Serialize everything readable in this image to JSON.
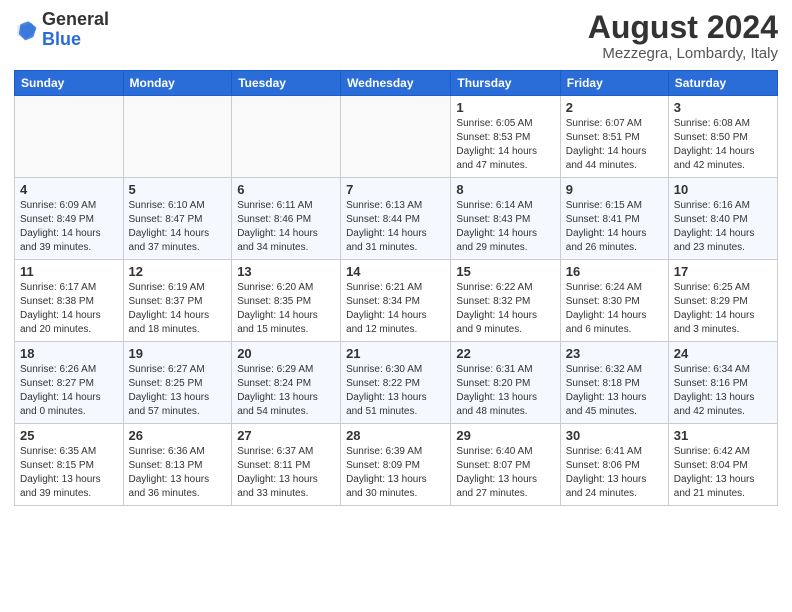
{
  "header": {
    "logo_general": "General",
    "logo_blue": "Blue",
    "month_title": "August 2024",
    "location": "Mezzegra, Lombardy, Italy"
  },
  "days_of_week": [
    "Sunday",
    "Monday",
    "Tuesday",
    "Wednesday",
    "Thursday",
    "Friday",
    "Saturday"
  ],
  "weeks": [
    [
      {
        "day": "",
        "info": ""
      },
      {
        "day": "",
        "info": ""
      },
      {
        "day": "",
        "info": ""
      },
      {
        "day": "",
        "info": ""
      },
      {
        "day": "1",
        "info": "Sunrise: 6:05 AM\nSunset: 8:53 PM\nDaylight: 14 hours\nand 47 minutes."
      },
      {
        "day": "2",
        "info": "Sunrise: 6:07 AM\nSunset: 8:51 PM\nDaylight: 14 hours\nand 44 minutes."
      },
      {
        "day": "3",
        "info": "Sunrise: 6:08 AM\nSunset: 8:50 PM\nDaylight: 14 hours\nand 42 minutes."
      }
    ],
    [
      {
        "day": "4",
        "info": "Sunrise: 6:09 AM\nSunset: 8:49 PM\nDaylight: 14 hours\nand 39 minutes."
      },
      {
        "day": "5",
        "info": "Sunrise: 6:10 AM\nSunset: 8:47 PM\nDaylight: 14 hours\nand 37 minutes."
      },
      {
        "day": "6",
        "info": "Sunrise: 6:11 AM\nSunset: 8:46 PM\nDaylight: 14 hours\nand 34 minutes."
      },
      {
        "day": "7",
        "info": "Sunrise: 6:13 AM\nSunset: 8:44 PM\nDaylight: 14 hours\nand 31 minutes."
      },
      {
        "day": "8",
        "info": "Sunrise: 6:14 AM\nSunset: 8:43 PM\nDaylight: 14 hours\nand 29 minutes."
      },
      {
        "day": "9",
        "info": "Sunrise: 6:15 AM\nSunset: 8:41 PM\nDaylight: 14 hours\nand 26 minutes."
      },
      {
        "day": "10",
        "info": "Sunrise: 6:16 AM\nSunset: 8:40 PM\nDaylight: 14 hours\nand 23 minutes."
      }
    ],
    [
      {
        "day": "11",
        "info": "Sunrise: 6:17 AM\nSunset: 8:38 PM\nDaylight: 14 hours\nand 20 minutes."
      },
      {
        "day": "12",
        "info": "Sunrise: 6:19 AM\nSunset: 8:37 PM\nDaylight: 14 hours\nand 18 minutes."
      },
      {
        "day": "13",
        "info": "Sunrise: 6:20 AM\nSunset: 8:35 PM\nDaylight: 14 hours\nand 15 minutes."
      },
      {
        "day": "14",
        "info": "Sunrise: 6:21 AM\nSunset: 8:34 PM\nDaylight: 14 hours\nand 12 minutes."
      },
      {
        "day": "15",
        "info": "Sunrise: 6:22 AM\nSunset: 8:32 PM\nDaylight: 14 hours\nand 9 minutes."
      },
      {
        "day": "16",
        "info": "Sunrise: 6:24 AM\nSunset: 8:30 PM\nDaylight: 14 hours\nand 6 minutes."
      },
      {
        "day": "17",
        "info": "Sunrise: 6:25 AM\nSunset: 8:29 PM\nDaylight: 14 hours\nand 3 minutes."
      }
    ],
    [
      {
        "day": "18",
        "info": "Sunrise: 6:26 AM\nSunset: 8:27 PM\nDaylight: 14 hours\nand 0 minutes."
      },
      {
        "day": "19",
        "info": "Sunrise: 6:27 AM\nSunset: 8:25 PM\nDaylight: 13 hours\nand 57 minutes."
      },
      {
        "day": "20",
        "info": "Sunrise: 6:29 AM\nSunset: 8:24 PM\nDaylight: 13 hours\nand 54 minutes."
      },
      {
        "day": "21",
        "info": "Sunrise: 6:30 AM\nSunset: 8:22 PM\nDaylight: 13 hours\nand 51 minutes."
      },
      {
        "day": "22",
        "info": "Sunrise: 6:31 AM\nSunset: 8:20 PM\nDaylight: 13 hours\nand 48 minutes."
      },
      {
        "day": "23",
        "info": "Sunrise: 6:32 AM\nSunset: 8:18 PM\nDaylight: 13 hours\nand 45 minutes."
      },
      {
        "day": "24",
        "info": "Sunrise: 6:34 AM\nSunset: 8:16 PM\nDaylight: 13 hours\nand 42 minutes."
      }
    ],
    [
      {
        "day": "25",
        "info": "Sunrise: 6:35 AM\nSunset: 8:15 PM\nDaylight: 13 hours\nand 39 minutes."
      },
      {
        "day": "26",
        "info": "Sunrise: 6:36 AM\nSunset: 8:13 PM\nDaylight: 13 hours\nand 36 minutes."
      },
      {
        "day": "27",
        "info": "Sunrise: 6:37 AM\nSunset: 8:11 PM\nDaylight: 13 hours\nand 33 minutes."
      },
      {
        "day": "28",
        "info": "Sunrise: 6:39 AM\nSunset: 8:09 PM\nDaylight: 13 hours\nand 30 minutes."
      },
      {
        "day": "29",
        "info": "Sunrise: 6:40 AM\nSunset: 8:07 PM\nDaylight: 13 hours\nand 27 minutes."
      },
      {
        "day": "30",
        "info": "Sunrise: 6:41 AM\nSunset: 8:06 PM\nDaylight: 13 hours\nand 24 minutes."
      },
      {
        "day": "31",
        "info": "Sunrise: 6:42 AM\nSunset: 8:04 PM\nDaylight: 13 hours\nand 21 minutes."
      }
    ]
  ]
}
